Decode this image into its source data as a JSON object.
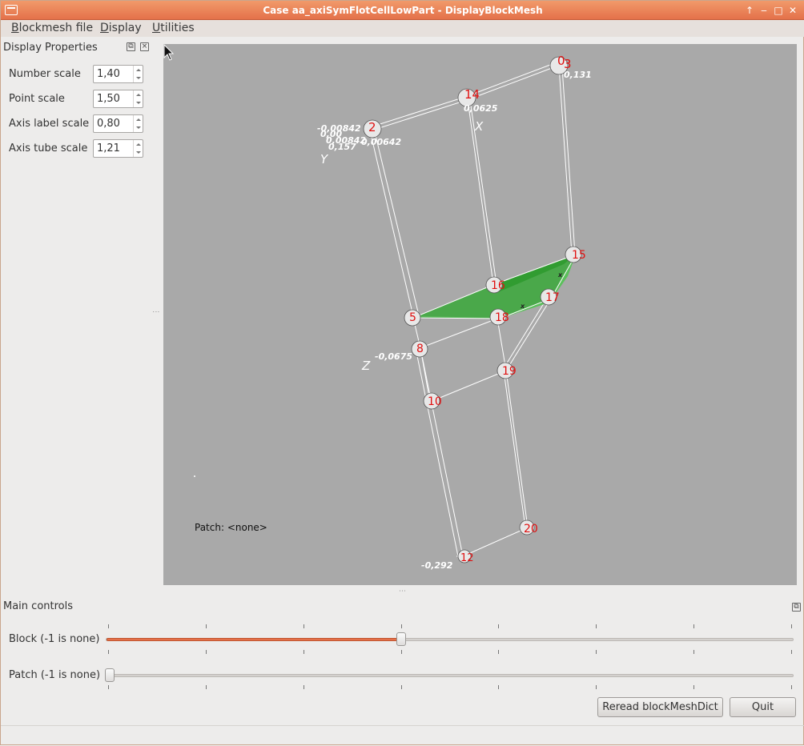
{
  "window": {
    "title": "Case aa_axiSymFlotCellLowPart - DisplayBlockMesh",
    "controls": [
      "↑",
      "‒",
      "□",
      "✕"
    ]
  },
  "menu": {
    "items": [
      {
        "label": "Blockmesh file",
        "mnemonic": "B",
        "rest": "lockmesh file"
      },
      {
        "label": "Display",
        "mnemonic": "D",
        "rest": "isplay"
      },
      {
        "label": "Utilities",
        "mnemonic": "U",
        "rest": "tilities"
      }
    ]
  },
  "display_properties": {
    "title": "Display Properties",
    "rows": [
      {
        "label": "Number scale",
        "value": "1,40"
      },
      {
        "label": "Point scale",
        "value": "1,50"
      },
      {
        "label": "Axis label scale",
        "value": "0,80"
      },
      {
        "label": "Axis tube scale",
        "value": "1,21"
      }
    ]
  },
  "viewport": {
    "background": "#a9a9a9",
    "patch_text": "Patch: <none>",
    "axis_labels": {
      "x": "X",
      "y": "Y",
      "z": "Z"
    },
    "tick_labels": [
      "-0,00842",
      "0,00",
      "0,00842",
      "0,157",
      "0,00642",
      "0,0625",
      "0,131",
      "-0,0675",
      "-0,292",
      "x",
      "x"
    ],
    "vertex_numbers": [
      "0",
      "3",
      "14",
      "2",
      "15",
      "16",
      "5",
      "18",
      "17",
      "8",
      "19",
      "10",
      "20",
      "12"
    ],
    "highlight_color": "#3aa83a",
    "vertex_number_color": "#e01010"
  },
  "main_controls": {
    "title": "Main controls",
    "block_label": "Block (-1 is none)",
    "block_value_fraction": 0.43,
    "patch_label": "Patch (-1 is none)",
    "patch_value_fraction": 0.0,
    "reread_button": "Reread blockMeshDict",
    "quit_button": "Quit"
  },
  "colors": {
    "accent": "#e4704a",
    "title_bar": "#ea8257"
  }
}
